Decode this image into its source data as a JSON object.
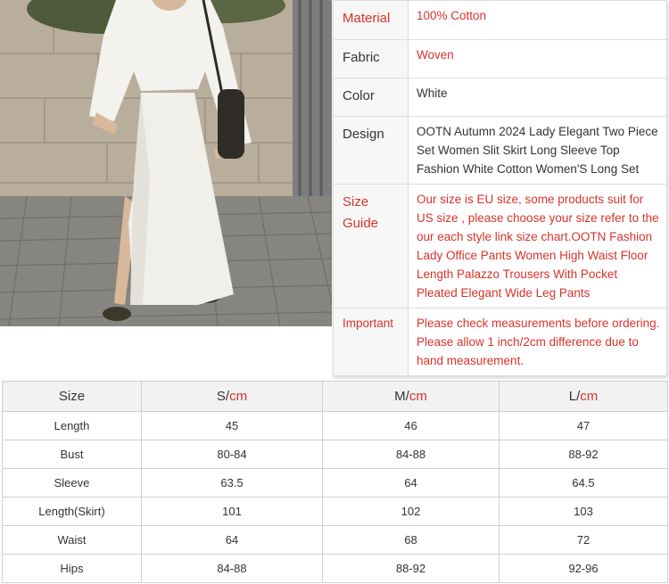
{
  "attributes": [
    {
      "key": "Material",
      "value": "100% Cotton",
      "key_red": true,
      "value_red": true
    },
    {
      "key": "Fabric",
      "value": "Woven",
      "key_red": false,
      "value_red": true
    },
    {
      "key": "Color",
      "value": "White",
      "key_red": false,
      "value_red": false
    },
    {
      "key": "Design",
      "value": "OOTN Autumn 2024 Lady Elegant Two Piece Set Women Slit Skirt Long Sleeve Top Fashion White Cotton Women'S Long Set",
      "key_red": false,
      "value_red": false
    },
    {
      "key": "Size Guide",
      "value": "Our size is EU size, some products suit for US size , please choose your size refer to the our each style link size chart.OOTN Fashion Lady Office Pants Women High Waist Floor Length Palazzo Trousers With Pocket Pleated Elegant Wide Leg Pants",
      "key_red": true,
      "value_red": true
    },
    {
      "key": "Important",
      "value": "Please check measurements before ordering. Please allow 1 inch/2cm difference due to hand measurement.",
      "key_red": true,
      "value_red": true
    }
  ],
  "size_chart": {
    "header": {
      "label": "Size",
      "unit": "cm",
      "sizes": [
        "S/",
        "M/",
        "L/"
      ]
    },
    "rows": [
      {
        "label": "Length",
        "values": [
          "45",
          "46",
          "47"
        ]
      },
      {
        "label": "Bust",
        "values": [
          "80-84",
          "84-88",
          "88-92"
        ]
      },
      {
        "label": "Sleeve",
        "values": [
          "63.5",
          "64",
          "64.5"
        ]
      },
      {
        "label": "Length(Skirt)",
        "values": [
          "101",
          "102",
          "103"
        ]
      },
      {
        "label": "Waist",
        "values": [
          "64",
          "68",
          "72"
        ]
      },
      {
        "label": "Hips",
        "values": [
          "84-88",
          "88-92",
          "92-96"
        ]
      }
    ]
  },
  "colors": {
    "accent_red": "#d9332b",
    "garment": "#f1efe9"
  }
}
